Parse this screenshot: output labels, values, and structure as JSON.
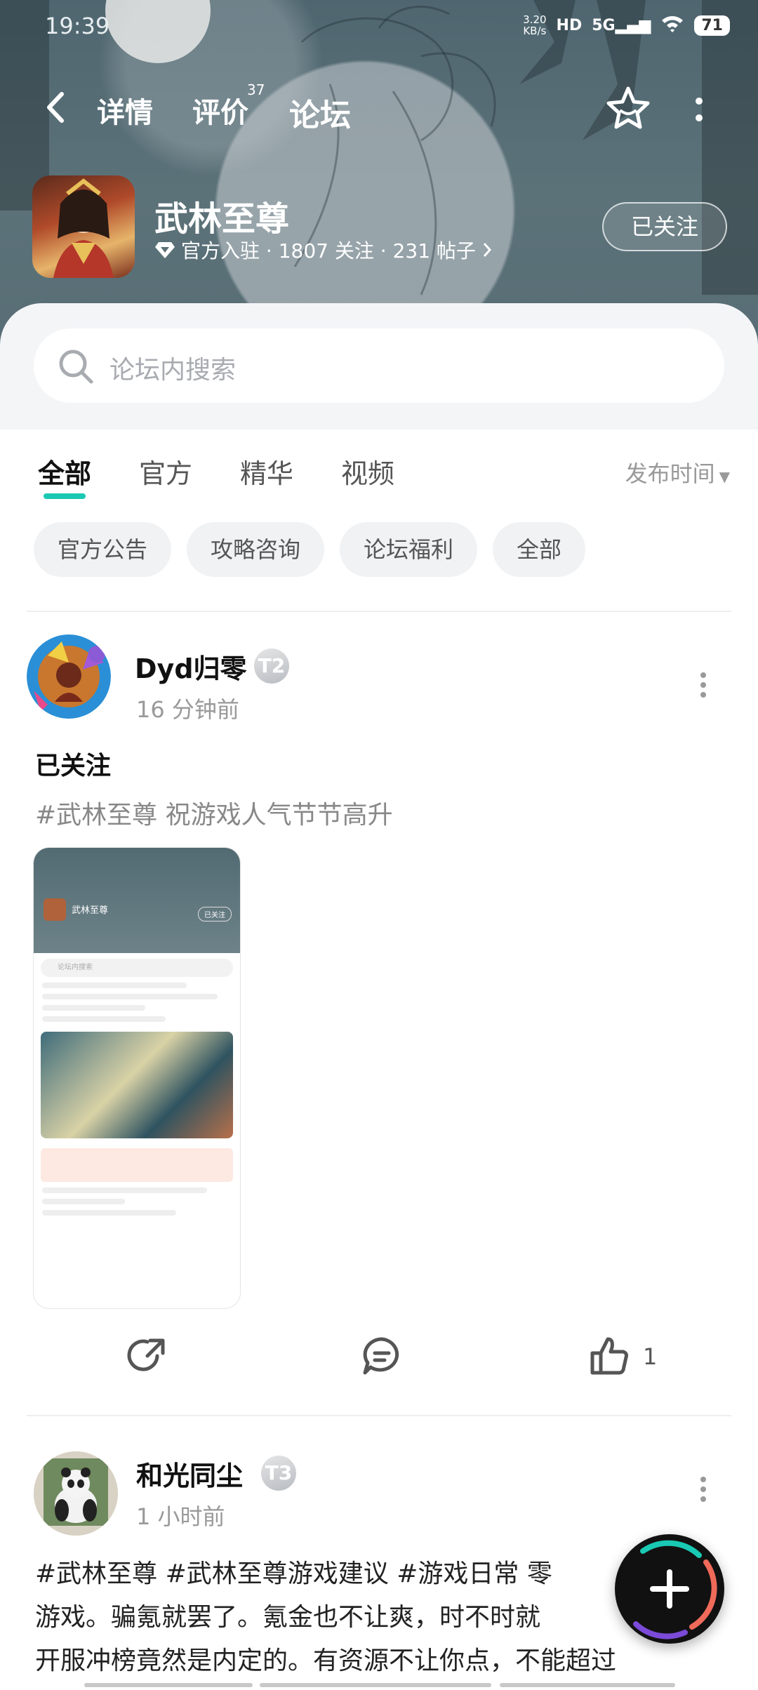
{
  "status_bar": {
    "time": "19:39",
    "net_speed_value": "3.20",
    "net_speed_unit": "KB/s",
    "hd": "HD",
    "network": "5G",
    "battery": "71"
  },
  "nav": {
    "tabs": [
      {
        "label": "详情"
      },
      {
        "label": "评价",
        "badge": "37"
      },
      {
        "label": "论坛",
        "active": true
      }
    ]
  },
  "game": {
    "title": "武林至尊",
    "meta": "官方入驻 · 1807 关注 · 231 帖子",
    "follow_label": "已关注"
  },
  "search": {
    "placeholder": "论坛内搜索"
  },
  "tabs": {
    "items": [
      {
        "label": "全部",
        "active": true
      },
      {
        "label": "官方"
      },
      {
        "label": "精华"
      },
      {
        "label": "视频"
      }
    ],
    "sort_label": "发布时间"
  },
  "chips": [
    "官方公告",
    "攻略咨询",
    "论坛福利",
    "全部"
  ],
  "posts": [
    {
      "author": "Dyd归零",
      "level": "T2",
      "time": "16 分钟前",
      "title": "已关注",
      "tags": "#武林至尊 祝游戏人气节节高升",
      "likes": "1"
    },
    {
      "author": "和光同尘",
      "level": "T3",
      "time": "1 小时前",
      "body_line1": "#武林至尊 #武林至尊游戏建议 #游戏日常 零",
      "body_line2": "游戏。骗氪就罢了。氪金也不让爽，时不时就",
      "body_line3": "开服冲榜竟然是内定的。有资源不让你点，不能超过"
    }
  ],
  "screenshot_thumb": {
    "title": "武林至尊",
    "follow": "已关注",
    "search": "论坛内搜索"
  },
  "colors": {
    "accent": "#19c9b3",
    "header_bg": "#566b73"
  }
}
